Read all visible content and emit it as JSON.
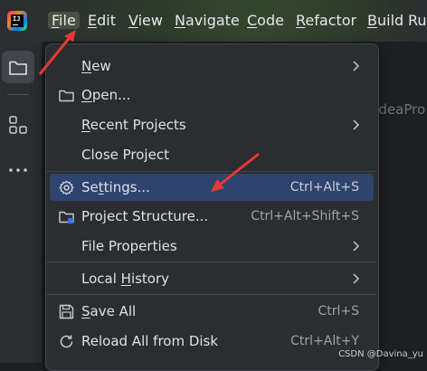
{
  "menubar": {
    "items": [
      "File",
      "Edit",
      "View",
      "Navigate",
      "Code",
      "Refactor",
      "Build",
      "Ru"
    ],
    "mnemonics": [
      "F",
      "E",
      "V",
      "N",
      "C",
      "R",
      "B",
      ""
    ],
    "rest": [
      "ile",
      "dit",
      "iew",
      "avigate",
      "ode",
      "efactor",
      "uild",
      "Ru"
    ],
    "active": "File",
    "logo_text": "IJ"
  },
  "editor": {
    "hint": "IdeaPro"
  },
  "file_menu": {
    "items": [
      {
        "label": "New",
        "mnemonic": "N",
        "rest": "ew",
        "shortcut": "",
        "submenu": true,
        "icon": ""
      },
      {
        "label": "Open...",
        "mnemonic": "O",
        "rest": "pen...",
        "shortcut": "",
        "submenu": false,
        "icon": "folder-icon"
      },
      {
        "label": "Recent Projects",
        "mnemonic": "R",
        "rest": "ecent Projects",
        "shortcut": "",
        "submenu": true,
        "icon": ""
      },
      {
        "label": "Close Project",
        "mnemonic": "",
        "rest": "Close Project",
        "shortcut": "",
        "submenu": false,
        "icon": ""
      },
      {
        "label": "Settings...",
        "mnemonic": "",
        "pre": "Se",
        "umark": "t",
        "post": "tings...",
        "shortcut": "Ctrl+Alt+S",
        "submenu": false,
        "icon": "gear-icon",
        "selected": true
      },
      {
        "label": "Project Structure...",
        "mnemonic": "",
        "rest": "Project Structure...",
        "shortcut": "Ctrl+Alt+Shift+S",
        "submenu": false,
        "icon": "project-structure-icon"
      },
      {
        "label": "File Properties",
        "mnemonic": "",
        "rest": "File Properties",
        "shortcut": "",
        "submenu": true,
        "icon": ""
      },
      {
        "label": "Local History",
        "mnemonic": "",
        "pre": "Local ",
        "umark": "H",
        "post": "istory",
        "shortcut": "",
        "submenu": true,
        "icon": ""
      },
      {
        "label": "Save All",
        "mnemonic": "S",
        "rest": "ave All",
        "shortcut": "Ctrl+S",
        "submenu": false,
        "icon": "save-icon"
      },
      {
        "label": "Reload All from Disk",
        "mnemonic": "",
        "rest": "Reload All from Disk",
        "shortcut": "Ctrl+Alt+Y",
        "submenu": false,
        "icon": "reload-icon"
      }
    ]
  },
  "watermark": "CSDN @Davina_yu",
  "colors": {
    "selection": "#2e436e",
    "annotation_arrow": "#e53935",
    "menu_bg": "#2b2d30"
  }
}
